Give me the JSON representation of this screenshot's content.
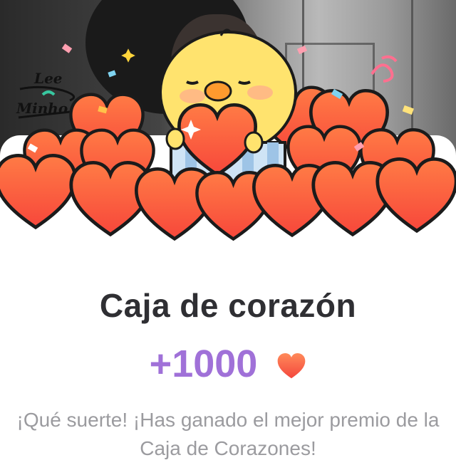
{
  "signature_text": "Lee Minho",
  "prize": {
    "title": "Caja de corazón",
    "amount": "+1000",
    "reward_icon": "heart-icon",
    "message": "¡Qué suerte! ¡Has ganado el mejor premio de la Caja de Corazones!"
  },
  "colors": {
    "heart_fill": "#ff5a3c",
    "amount_text": "#a071d8",
    "title_text": "#2f2f33",
    "message_text": "#9b9b9f",
    "chick_body": "#ffe36e"
  },
  "illustration": {
    "icons": [
      "chick-mascot-icon",
      "heart-icon",
      "gift-box-icon",
      "confetti-icon",
      "sparkle-icon"
    ]
  }
}
